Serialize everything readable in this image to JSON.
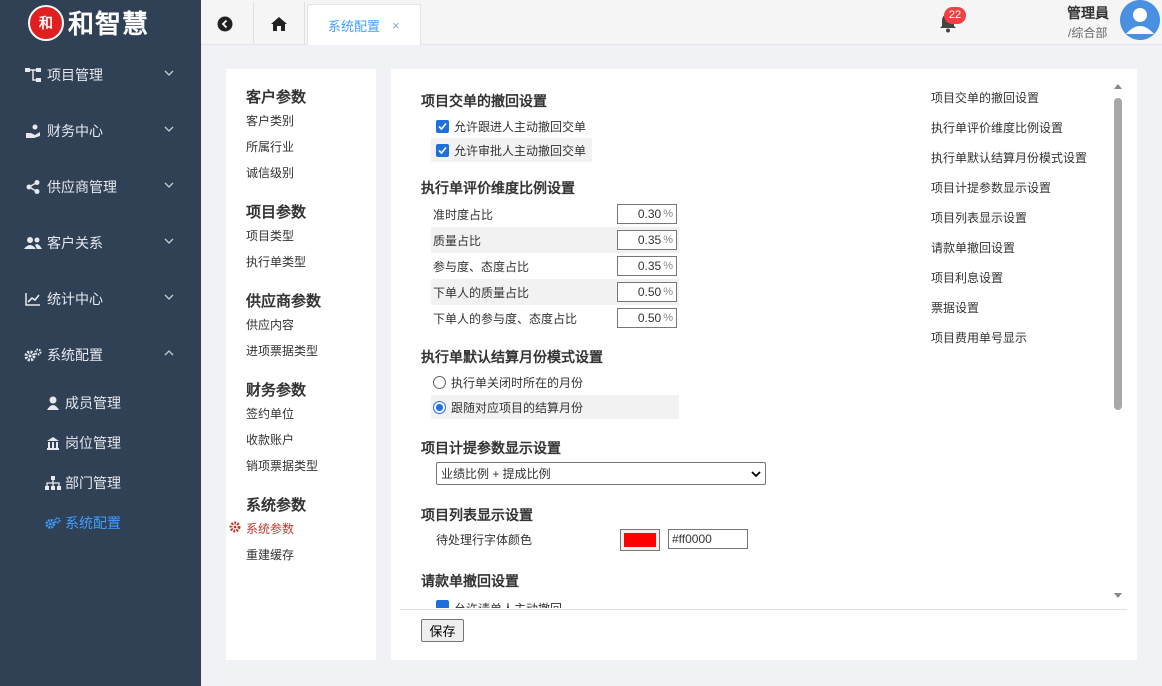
{
  "brand": {
    "logo_mark": "和",
    "name": "和智慧"
  },
  "sidebar": {
    "items": [
      {
        "label": "项目管理",
        "icon": "sitemap-icon"
      },
      {
        "label": "财务中心",
        "icon": "hand-coin-icon"
      },
      {
        "label": "供应商管理",
        "icon": "share-icon"
      },
      {
        "label": "客户关系",
        "icon": "users-icon"
      },
      {
        "label": "统计中心",
        "icon": "chart-line-icon"
      },
      {
        "label": "系统配置",
        "icon": "cogs-icon",
        "expanded": true
      }
    ],
    "sub_items": [
      {
        "label": "成员管理",
        "icon": "user-icon"
      },
      {
        "label": "岗位管理",
        "icon": "building-icon"
      },
      {
        "label": "部门管理",
        "icon": "org-chart-icon"
      },
      {
        "label": "系统配置",
        "icon": "cogs-icon",
        "active": true
      }
    ]
  },
  "topbar": {
    "active_tab": "系统配置",
    "close_symbol": "×",
    "notification_count": "22",
    "user_name": "管理員",
    "user_dept": "/综合部"
  },
  "categories": {
    "groups": [
      {
        "title": "客户参数",
        "items": [
          "客户类别",
          "所属行业",
          "诚信级别"
        ]
      },
      {
        "title": "项目参数",
        "items": [
          "项目类型",
          "执行单类型"
        ]
      },
      {
        "title": "供应商参数",
        "items": [
          "供应内容",
          "进项票据类型"
        ]
      },
      {
        "title": "财务参数",
        "items": [
          "签约单位",
          "收款账户",
          "销项票据类型"
        ]
      },
      {
        "title": "系统参数",
        "items": [
          "系统参数",
          "重建缓存"
        ]
      }
    ],
    "active_item": "系统参数"
  },
  "settings": {
    "withdraw": {
      "title": "项目交单的撤回设置",
      "options": [
        {
          "label": "允许跟进人主动撤回交单",
          "checked": true
        },
        {
          "label": "允许审批人主动撤回交单",
          "checked": true
        }
      ]
    },
    "ratio": {
      "title": "执行单评价维度比例设置",
      "unit": "%",
      "rows": [
        {
          "label": "准时度占比",
          "value": "0.30"
        },
        {
          "label": "质量占比",
          "value": "0.35"
        },
        {
          "label": "参与度、态度占比",
          "value": "0.35"
        },
        {
          "label": "下单人的质量占比",
          "value": "0.50"
        },
        {
          "label": "下单人的参与度、态度占比",
          "value": "0.50"
        }
      ]
    },
    "month_mode": {
      "title": "执行单默认结算月份模式设置",
      "options": [
        {
          "label": "执行单关闭时所在的月份",
          "selected": false
        },
        {
          "label": "跟随对应项目的结算月份",
          "selected": true
        }
      ]
    },
    "accrual": {
      "title": "项目计提参数显示设置",
      "selected": "业绩比例 + 提成比例"
    },
    "list_display": {
      "title": "项目列表显示设置",
      "color_label": "待处理行字体颜色",
      "color_value": "#ff0000"
    },
    "payment_withdraw": {
      "title": "请款单撤回设置",
      "partial_option": "允许请单人主动撤回"
    },
    "save_label": "保存"
  },
  "anchors": [
    "项目交单的撤回设置",
    "执行单评价维度比例设置",
    "执行单默认结算月份模式设置",
    "项目计提参数显示设置",
    "项目列表显示设置",
    "请款单撤回设置",
    "项目利息设置",
    "票据设置",
    "项目费用单号显示"
  ],
  "colors": {
    "sidebar_bg": "#304156",
    "accent": "#409eff",
    "checkbox": "#1e6fd9",
    "badge": "#f04040"
  }
}
